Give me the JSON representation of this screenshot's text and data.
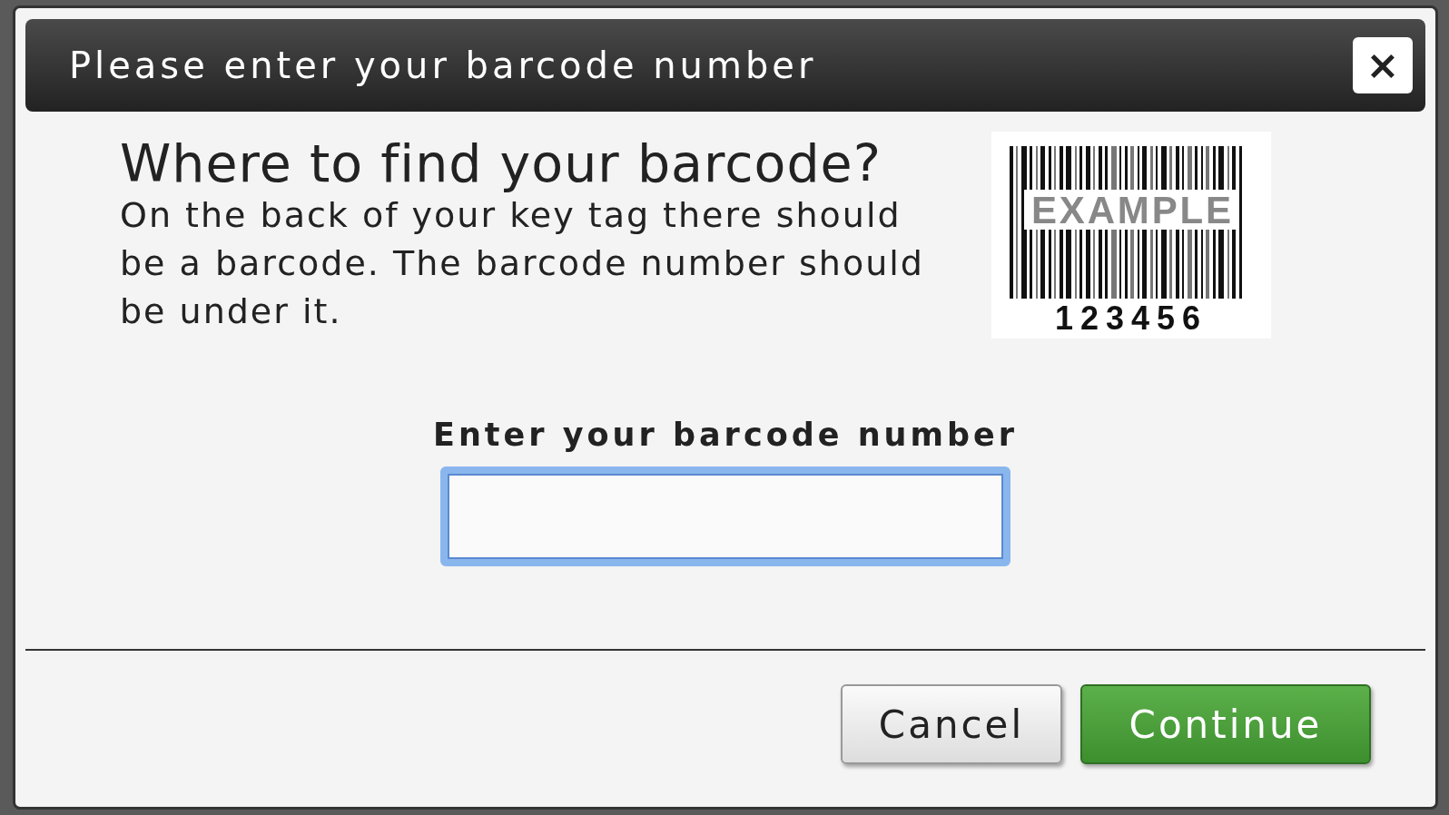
{
  "dialog": {
    "title": "Please enter your barcode number",
    "close_label": "×"
  },
  "help": {
    "heading": "Where to find your barcode?",
    "text": "On the back of your key tag there should be a barcode. The barcode number should be under it.",
    "barcode_example": {
      "overlay": "EXAMPLE",
      "digits": "123456"
    }
  },
  "field": {
    "label": "Enter your barcode number",
    "focused": true
  },
  "buttons": [
    {
      "label": "Cancel",
      "kind": "secondary"
    },
    {
      "label": "Continue",
      "kind": "primary"
    }
  ]
}
